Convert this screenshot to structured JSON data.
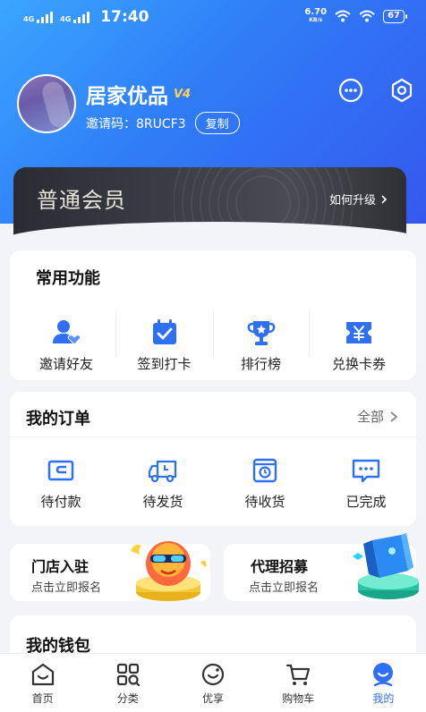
{
  "status": {
    "network_left_1": "4G",
    "network_left_2": "4G",
    "time": "17:40",
    "speed": "6.70",
    "speed_unit": "KB/s",
    "battery": "67"
  },
  "profile": {
    "name": "居家优品",
    "level": "V4",
    "invite_label": "邀请码：",
    "invite_code": "8RUCF3",
    "copy_label": "复制"
  },
  "vip": {
    "title": "普通会员",
    "upgrade_label": "如何升级"
  },
  "functions": {
    "title": "常用功能",
    "items": [
      {
        "label": "邀请好友",
        "icon": "invite-friend-icon"
      },
      {
        "label": "签到打卡",
        "icon": "checkin-calendar-icon"
      },
      {
        "label": "排行榜",
        "icon": "trophy-icon"
      },
      {
        "label": "兑换卡券",
        "icon": "coupon-icon"
      }
    ]
  },
  "orders": {
    "title": "我的订单",
    "all_label": "全部",
    "items": [
      {
        "label": "待付款",
        "icon": "wallet-icon"
      },
      {
        "label": "待发货",
        "icon": "truck-icon"
      },
      {
        "label": "待收货",
        "icon": "package-clock-icon"
      },
      {
        "label": "已完成",
        "icon": "message-done-icon"
      }
    ]
  },
  "promos": [
    {
      "title": "门店入驻",
      "subtitle": "点击立即报名"
    },
    {
      "title": "代理招募",
      "subtitle": "点击立即报名"
    }
  ],
  "wallet": {
    "title": "我的钱包"
  },
  "tabbar": [
    {
      "label": "首页",
      "active": false
    },
    {
      "label": "分类",
      "active": false
    },
    {
      "label": "优享",
      "active": false
    },
    {
      "label": "购物车",
      "active": false
    },
    {
      "label": "我的",
      "active": true
    }
  ],
  "colors": {
    "header_start": "#3aa5ff",
    "header_end": "#3558ee",
    "icon_blue": "#2f6ff2",
    "vip_dark": "#2a2c33"
  }
}
